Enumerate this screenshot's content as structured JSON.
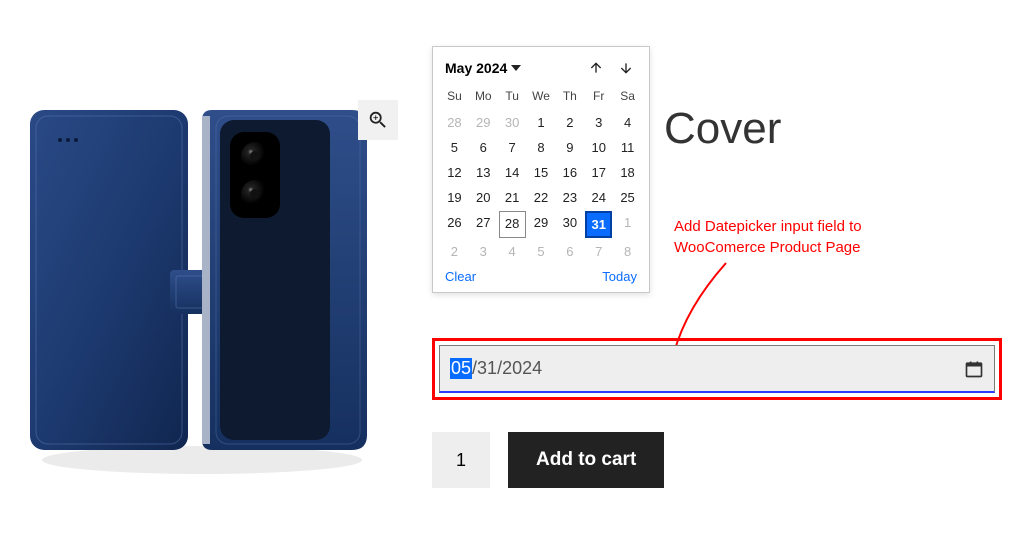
{
  "product": {
    "title": "Cover",
    "image_alt": "blue-leather-phone-wallet-case"
  },
  "datepicker": {
    "month_label": "May 2024",
    "days_of_week": [
      "Su",
      "Mo",
      "Tu",
      "We",
      "Th",
      "Fr",
      "Sa"
    ],
    "weeks": [
      [
        {
          "n": "28",
          "cls": "other"
        },
        {
          "n": "29",
          "cls": "other"
        },
        {
          "n": "30",
          "cls": "other"
        },
        {
          "n": "1"
        },
        {
          "n": "2"
        },
        {
          "n": "3"
        },
        {
          "n": "4"
        }
      ],
      [
        {
          "n": "5"
        },
        {
          "n": "6"
        },
        {
          "n": "7"
        },
        {
          "n": "8"
        },
        {
          "n": "9"
        },
        {
          "n": "10"
        },
        {
          "n": "11"
        }
      ],
      [
        {
          "n": "12"
        },
        {
          "n": "13"
        },
        {
          "n": "14"
        },
        {
          "n": "15"
        },
        {
          "n": "16"
        },
        {
          "n": "17"
        },
        {
          "n": "18"
        }
      ],
      [
        {
          "n": "19"
        },
        {
          "n": "20"
        },
        {
          "n": "21"
        },
        {
          "n": "22"
        },
        {
          "n": "23"
        },
        {
          "n": "24"
        },
        {
          "n": "25"
        }
      ],
      [
        {
          "n": "26"
        },
        {
          "n": "27"
        },
        {
          "n": "28",
          "cls": "today"
        },
        {
          "n": "29"
        },
        {
          "n": "30"
        },
        {
          "n": "31",
          "cls": "selected"
        },
        {
          "n": "1",
          "cls": "other"
        }
      ],
      [
        {
          "n": "2",
          "cls": "other"
        },
        {
          "n": "3",
          "cls": "other"
        },
        {
          "n": "4",
          "cls": "other"
        },
        {
          "n": "5",
          "cls": "other"
        },
        {
          "n": "6",
          "cls": "other"
        },
        {
          "n": "7",
          "cls": "other"
        },
        {
          "n": "8",
          "cls": "other"
        }
      ]
    ],
    "clear_label": "Clear",
    "today_label": "Today"
  },
  "date_field": {
    "month": "05",
    "sep1": "/",
    "day": "31",
    "sep2": "/",
    "year": "2024"
  },
  "annotation": {
    "line1": "Add Datepicker input field to",
    "line2": "WooComerce Product Page"
  },
  "cart": {
    "quantity": "1",
    "add_label": "Add to cart"
  },
  "colors": {
    "accent": "#0a6cff",
    "annotation": "#ff0000",
    "product": "#1d3a70"
  }
}
